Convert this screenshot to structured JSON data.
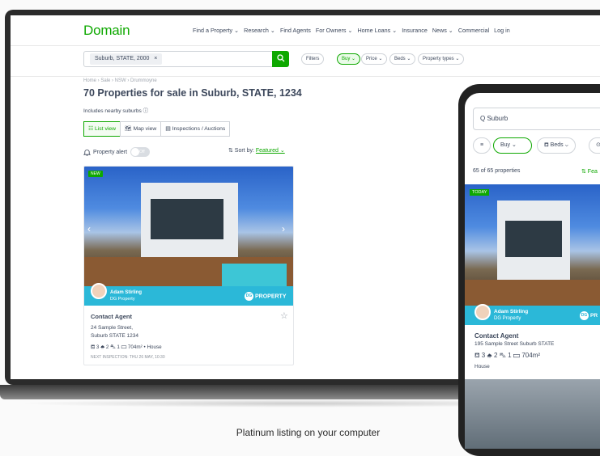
{
  "header": {
    "logo": "Domain",
    "nav": [
      "Find a Property ⌄",
      "Research ⌄",
      "Find Agents",
      "For Owners ⌄",
      "Home Loans ⌄",
      "Insurance",
      "News ⌄",
      "Commercial",
      "Log in"
    ]
  },
  "search": {
    "chip": "Suburb, STATE, 2000",
    "chip_remove": "×",
    "button_icon": "search-icon",
    "filters": [
      "Filters",
      "Buy ⌄",
      "Price ⌄",
      "Beds ⌄",
      "Property types ⌄"
    ]
  },
  "breadcrumb": "Home › Sale › NSW › Drummoyne",
  "page_title": "70 Properties for sale in Suburb, STATE, 1234",
  "nearby": "Includes nearby suburbs ⓘ",
  "view_tabs": [
    "☷ List view",
    "🗺 Map view",
    "▤ Inspections / Auctions"
  ],
  "alert": {
    "label": "Property alert",
    "toggle": "Off"
  },
  "sort": {
    "label": "⇅ Sort by:",
    "value": "Featured ⌄"
  },
  "listing": {
    "badge": "NEW",
    "agent_name": "Adam Stirling",
    "agent_company": "DG Property",
    "brand": "PROPERTY",
    "brand_logo": "DG",
    "price": "Contact Agent",
    "address_line1": "24 Sample Street,",
    "address_line2": "Suburb STATE 1234",
    "features": "⛾ 3  ⛆ 2  ⛍ 1  ▭ 704m²  •  House",
    "inspection": "NEXT INSPECTION: THU 26 MAY, 10:30"
  },
  "phone": {
    "search_placeholder": "Q  Suburb",
    "pills": [
      "≡",
      "Buy ⌄",
      "⛾ Beds ⌄",
      "⊙"
    ],
    "count": "65 of 65 properties",
    "sort": "⇅ Fea",
    "badge": "TODAY",
    "agent_name": "Adam Stirling",
    "agent_company": "DG Property",
    "brand": "PR",
    "brand_logo": "DG",
    "price": "Contact Agent",
    "address": "195 Sample Street Suburb STATE",
    "features": "⛾ 3  ⛆ 2  ⛍ 1  ▭ 704m²",
    "type": "House"
  },
  "caption": "Platinum listing on your computer",
  "colors": {
    "accent": "#0ea800",
    "agent_bar": "#2bb8d8"
  }
}
